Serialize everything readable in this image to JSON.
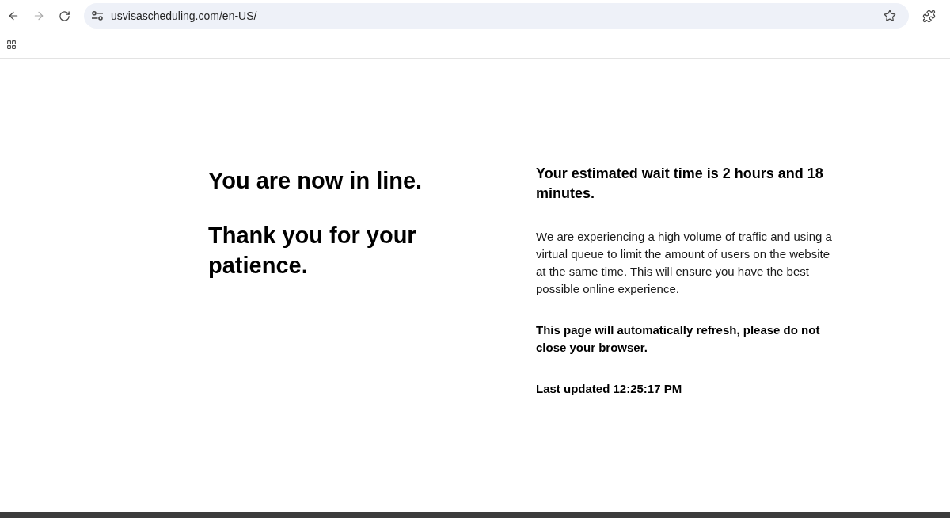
{
  "browser": {
    "back": {
      "disabled": false
    },
    "forward": {
      "disabled": true
    },
    "url": "usvisascheduling.com/en-US/"
  },
  "queue": {
    "headline": "You are now in line.",
    "thanks": "Thank you for your patience.",
    "wait_time": "Your estimated wait time is 2 hours and 18 minutes.",
    "message": "We are experiencing a high volume of traffic and using a virtual queue to limit the amount of users on the website at the same time. This will ensure you have the best possible online experience.",
    "notice": "This page will automatically refresh, please do not close your browser.",
    "last_updated": "Last updated 12:25:17 PM"
  }
}
